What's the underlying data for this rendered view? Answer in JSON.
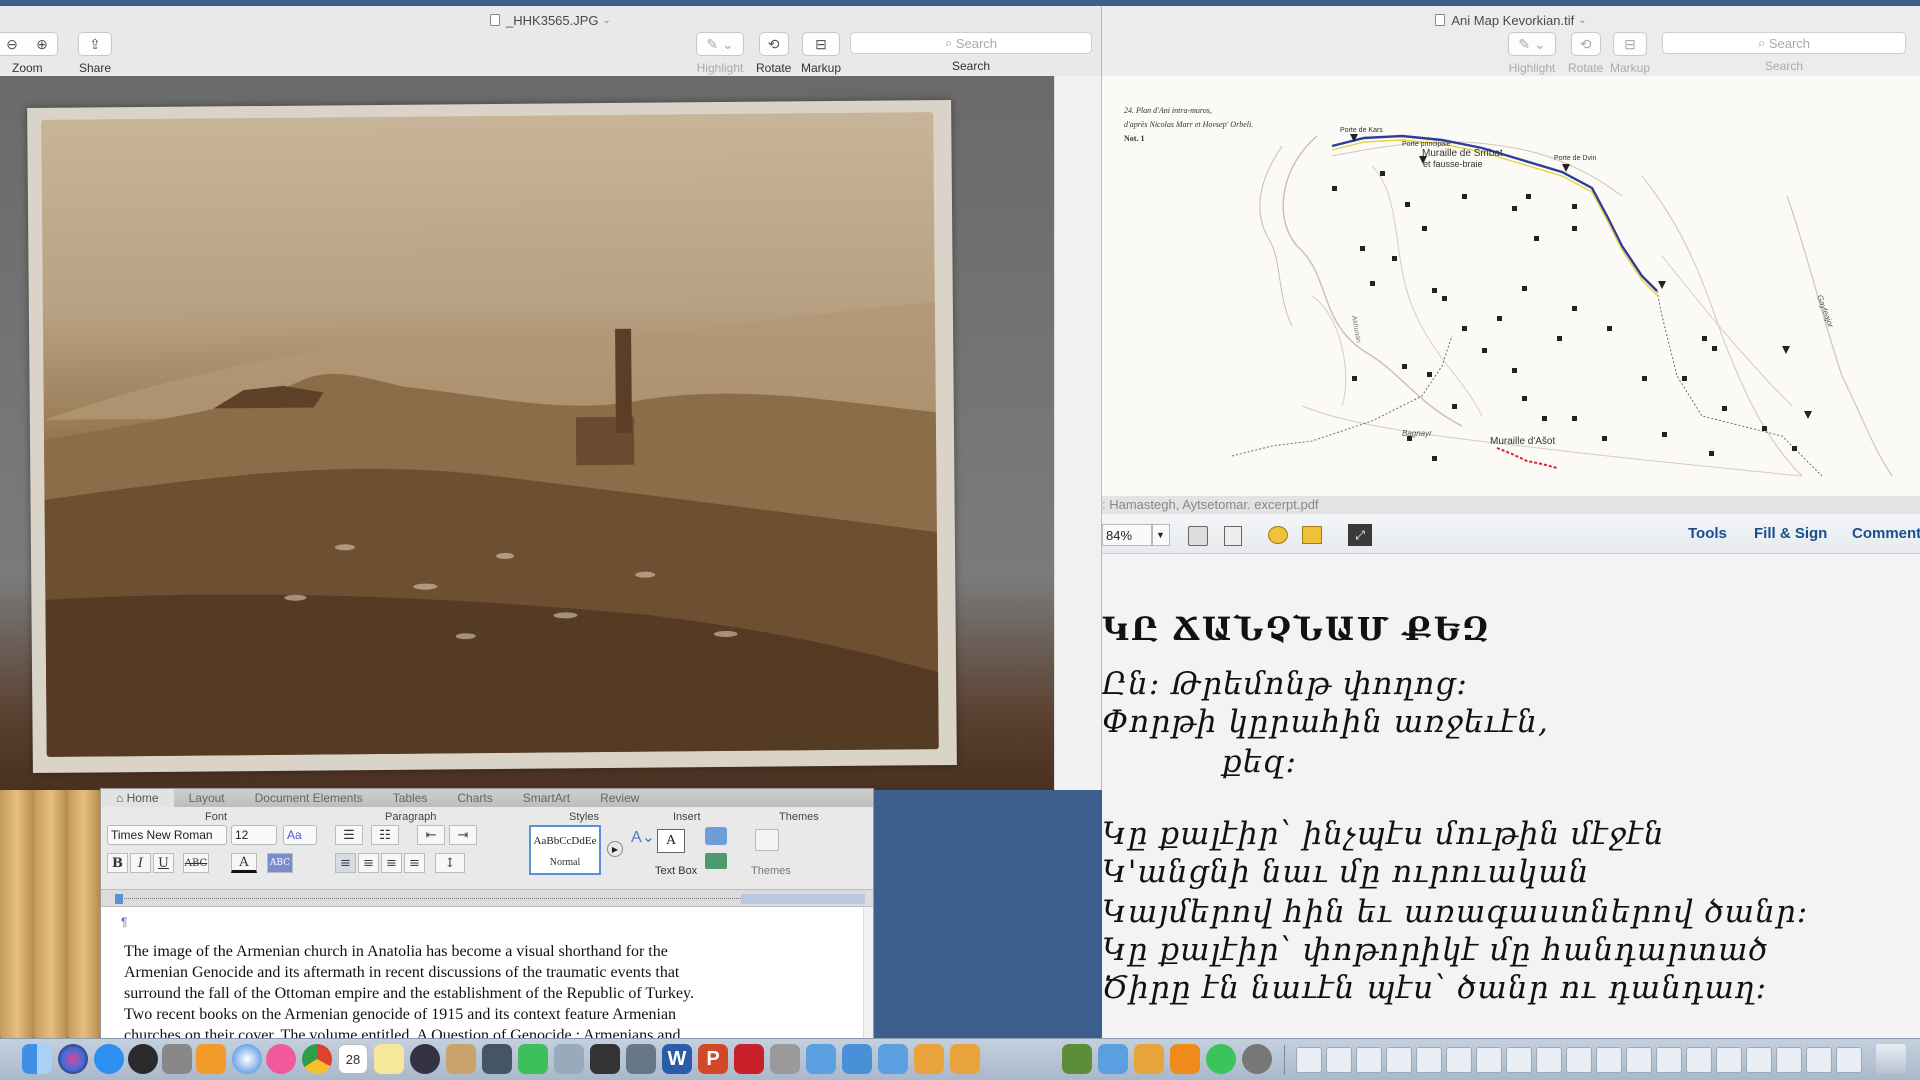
{
  "photo_window": {
    "title": "_HHK3565.JPG",
    "toolbar": {
      "zoom": "Zoom",
      "share": "Share",
      "highlight": "Highlight",
      "rotate": "Rotate",
      "markup": "Markup",
      "search_placeholder": "Search",
      "search_label": "Search"
    }
  },
  "map_window": {
    "title": "Ani Map Kevorkian.tif",
    "toolbar": {
      "highlight": "Highlight",
      "rotate": "Rotate",
      "markup": "Markup",
      "search_placeholder": "Search",
      "search_label": "Search"
    },
    "caption": {
      "line1": "24. Plan d'Ani intra-muros,",
      "line2": "d'après Nicolas Marr et Hovsep' Orbeli.",
      "line3": "Not. 1"
    },
    "labels": {
      "muraille_smbat": "Muraille de Smbat",
      "fausse_braie": "et fausse-braie",
      "porte_kars": "Porte de Kars",
      "porte_principale": "Porte principale",
      "porte_dvin": "Porte de Dvin",
      "muraille_ashot": "Muraille d'Ašot",
      "bagnayr": "Bagnayr",
      "gayleajor": "Gayleajor",
      "akhurian": "Akhurian"
    }
  },
  "pdf_window": {
    "title": "Hamastegh, Aytsetomar. excerpt.pdf",
    "zoom": "84%",
    "tools": "Tools",
    "fill_sign": "Fill & Sign",
    "comment": "Comment",
    "heading": "ԿԸ ՃԱՆՉՆԱՄ ՔԵԶ",
    "lines": [
      "Ըն: Թրեմոնթ փողոց:",
      "Փորթի կըրահին առջեւէն,",
      "քեզ:",
      "Կը քալէիր՝ ինչպէս մութին մէջէն",
      "Կ'անցնի նաւ մը ուրուական",
      "Կայմերով հին եւ առագաստներով ծանր:",
      "Կը քալէիր՝ փոթորիկէ մը հանդարտած",
      "Ծիրը էն նաւէն պէս՝ ծանր ու դանդաղ:"
    ]
  },
  "word_window": {
    "tabs": [
      "Home",
      "Layout",
      "Document Elements",
      "Tables",
      "Charts",
      "SmartArt",
      "Review"
    ],
    "groups": {
      "font": "Font",
      "paragraph": "Paragraph",
      "styles": "Styles",
      "insert": "Insert",
      "themes": "Themes"
    },
    "font_name": "Times New Roman",
    "font_size": "12",
    "style_preview": "AaBbCcDdEe",
    "style_name": "Normal",
    "text_box": "Text Box",
    "themes_label": "Themes",
    "pilcrow": "¶",
    "body_lines": [
      "The image of the Armenian church in Anatolia has become a visual shorthand for the",
      "Armenian Genocide and its aftermath in recent discussions of the traumatic events that",
      "surround the fall of the Ottoman empire and the establishment of the Republic of Turkey.",
      "Two recent books on the Armenian genocide of 1915 and its context feature Armenian",
      "churches on their cover. The volume entitled, A Question of Genocide : Armenians and"
    ]
  },
  "dock": {
    "calendar_day": "28"
  },
  "colors": {
    "accent": "#2a6fd6",
    "desktop": "#3d5f8e"
  }
}
